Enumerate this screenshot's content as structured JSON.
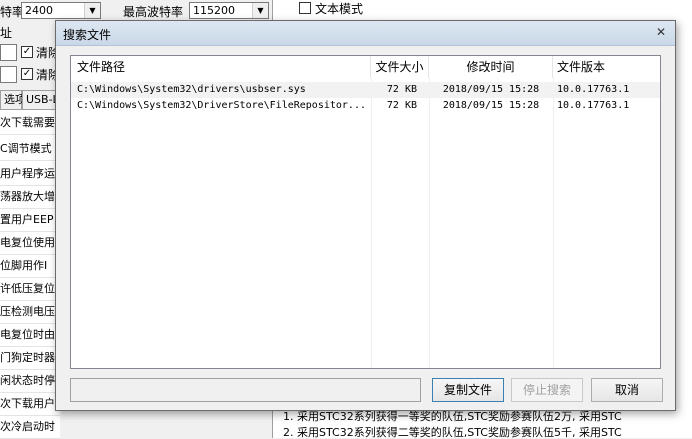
{
  "background": {
    "baud_label_partial": "特率",
    "baud_value": "2400",
    "max_baud_label": "最高波特率",
    "max_baud_value": "115200",
    "addr_label_partial": "址",
    "clear_label_1": "清除",
    "clear_label_2": "清除",
    "right_checkbox_label": "文本模式",
    "tabs": [
      "选项",
      "USB-L"
    ],
    "options": [
      "次下载需要",
      "C调节模式",
      "用户程序运",
      "荡器放大增",
      "置用户EEP",
      "电复位使用",
      "位脚用作I",
      "许低压复位",
      "压检测电压",
      "电复位时由",
      "门狗定时器",
      "闲状态时停",
      "次下载用户",
      "次冷启动时"
    ],
    "bottom_lines": [
      "1. 采用STC32系列获得一等奖的队伍,STC奖励参赛队伍2万, 采用STC",
      "2. 采用STC32系列获得二等奖的队伍,STC奖励参赛队伍5千, 采用STC"
    ]
  },
  "dialog": {
    "title": "搜索文件",
    "close_glyph": "✕",
    "columns": [
      "文件路径",
      "文件大小",
      "修改时间",
      "文件版本"
    ],
    "rows": [
      {
        "path": "C:\\Windows\\System32\\drivers\\usbser.sys",
        "size": "72 KB",
        "modified": "2018/09/15 15:28",
        "version": "10.0.17763.1"
      },
      {
        "path": "C:\\Windows\\System32\\DriverStore\\FileRepositor...",
        "size": "72 KB",
        "modified": "2018/09/15 15:28",
        "version": "10.0.17763.1"
      }
    ],
    "buttons": {
      "copy": "复制文件",
      "stop": "停止搜索",
      "cancel": "取消"
    }
  }
}
